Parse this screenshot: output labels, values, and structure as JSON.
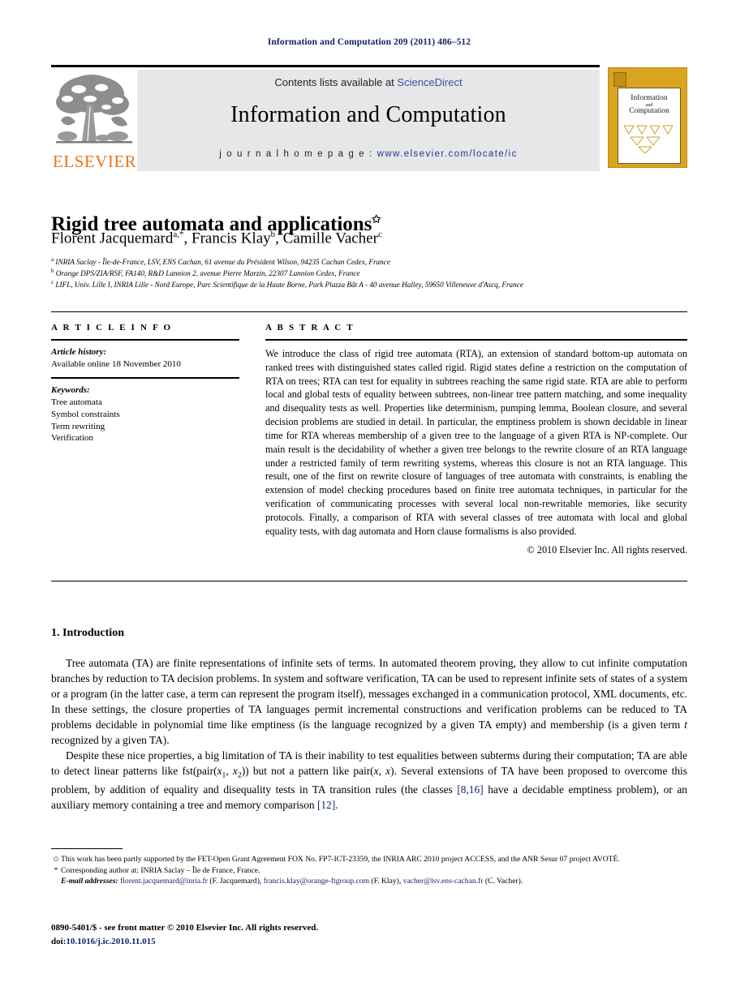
{
  "running_head": "Information and Computation 209 (2011) 486–512",
  "masthead": {
    "contents_prefix": "Contents lists available at ",
    "sciencedirect": "ScienceDirect",
    "journal_name": "Information and Computation",
    "homepage_label": "j o u r n a l   h o m e p a g e :",
    "homepage_url": "www.elsevier.com/locate/ic",
    "publisher": "ELSEVIER",
    "publisher_logo_icon": "elsevier-tree-logo",
    "sciencedirect_color": "#3b53a4",
    "url_color": "#2e3192",
    "panel_color": "#e6e7e8",
    "elsevier_orange": "#e87722"
  },
  "cover": {
    "line1": "Information",
    "line2": "and",
    "line3": "Computation",
    "background": "#d9a520",
    "icon": "journal-cover-thumbnail"
  },
  "article": {
    "title": "Rigid tree automata and applications",
    "title_footnote_marker": "✩",
    "authors": [
      {
        "name": "Florent Jacquemard",
        "marks": "a,*"
      },
      {
        "name": "Francis Klay",
        "marks": "b"
      },
      {
        "name": "Camille Vacher",
        "marks": "c"
      }
    ],
    "affiliations": [
      {
        "mark": "a",
        "text": "INRIA Saclay - Île-de-France, LSV, ENS Cachan, 61 avenue du Président Wilson, 94235 Cachan Cedex, France"
      },
      {
        "mark": "b",
        "text": "Orange DPS/ZIA/RSF, FA140, R&D Lannion 2, avenue Pierre Marzin, 22307 Lannion Cedex, France"
      },
      {
        "mark": "c",
        "text": "LIFL, Univ. Lille I, INRIA Lille - Nord Europe, Parc Scientifique de la Haute Borne, Park Plazza Bât A - 40 avenue Halley, 59650 Villeneuve d'Ascq, France"
      }
    ]
  },
  "info": {
    "heading": "A R T I C L E   I N F O",
    "history_label": "Article history:",
    "history_value": "Available online 18 November 2010",
    "keywords_label": "Keywords:",
    "keywords": [
      "Tree automata",
      "Symbol constraints",
      "Term rewriting",
      "Verification"
    ]
  },
  "abstract": {
    "heading": "A B S T R A C T",
    "text": "We introduce the class of rigid tree automata (RTA), an extension of standard bottom-up automata on ranked trees with distinguished states called rigid. Rigid states define a restriction on the computation of RTA on trees; RTA can test for equality in subtrees reaching the same rigid state. RTA are able to perform local and global tests of equality between subtrees, non-linear tree pattern matching, and some inequality and disequality tests as well. Properties like determinism, pumping lemma, Boolean closure, and several decision problems are studied in detail. In particular, the emptiness problem is shown decidable in linear time for RTA whereas membership of a given tree to the language of a given RTA is NP-complete. Our main result is the decidability of whether a given tree belongs to the rewrite closure of an RTA language under a restricted family of term rewriting systems, whereas this closure is not an RTA language. This result, one of the first on rewrite closure of languages of tree automata with constraints, is enabling the extension of model checking procedures based on finite tree automata techniques, in particular for the verification of communicating processes with several local non-rewritable memories, like security protocols. Finally, a comparison of RTA with several classes of tree automata with local and global equality tests, with dag automata and Horn clause formalisms is also provided.",
    "copyright": "© 2010 Elsevier Inc. All rights reserved."
  },
  "body": {
    "section_number": "1.",
    "section_title": "Introduction",
    "paragraph1_a": "Tree automata (TA) are finite representations of infinite sets of terms. In automated theorem proving, they allow to cut infinite computation branches by reduction to TA decision problems. In system and software verification, TA can be used to represent infinite sets of states of a system or a program (in the latter case, a term can represent the program itself), messages exchanged in a communication protocol, XML documents, etc. In these settings, the closure properties of TA languages permit incremental constructions and verification problems can be reduced to TA problems decidable in polynomial time like emptiness (is the language recognized by a given TA empty) and membership (is a given term ",
    "paragraph1_var": "t",
    "paragraph1_b": " recognized by a given TA).",
    "paragraph2_a": "Despite these nice properties, a big limitation of TA is their inability to test equalities between subterms during their computation; TA are able to detect linear patterns like fst(pair(",
    "paragraph2_x1": "x",
    "paragraph2_x1sub": "1",
    "paragraph2_mid1": ", ",
    "paragraph2_x2": "x",
    "paragraph2_x2sub": "2",
    "paragraph2_mid2": ")) but not a pattern like pair(",
    "paragraph2_x3": "x",
    "paragraph2_mid3": ", ",
    "paragraph2_x4": "x",
    "paragraph2_b": "). Several extensions of TA have been proposed to overcome this problem, by addition of equality and disequality tests in TA transition rules (the classes ",
    "paragraph2_ref1": "[8,16]",
    "paragraph2_c": " have a decidable emptiness problem), or an auxiliary memory containing a tree and memory comparison ",
    "paragraph2_ref2": "[12]",
    "paragraph2_d": "."
  },
  "footnotes": {
    "star_marker": "✩",
    "star_text": "This work has been partly supported by the FET-Open Grant Agreement FOX No. FP7-ICT-23359, the INRIA ARC 2010 project ACCESS, and the ANR Sesur 07 project AVOTÉ.",
    "corr_marker": "*",
    "corr_text": "Corresponding author at: INRIA Saclay – Île de France, France.",
    "email_label": "E-mail addresses:",
    "emails": [
      {
        "address": "florent.jacquemard@inria.fr",
        "owner": " (F. Jacquemard), "
      },
      {
        "address": "francis.klay@orange-ftgroup.com",
        "owner": " (F. Klay), "
      },
      {
        "address": "vacher@lsv.ens-cachan.fr",
        "owner": " (C. Vacher)."
      }
    ],
    "email_color": "#14236b"
  },
  "imprint": {
    "issn_line": "0890-5401/$ - see front matter © 2010 Elsevier Inc. All rights reserved.",
    "doi_label": "doi:",
    "doi_value": "10.1016/j.ic.2010.11.015"
  }
}
